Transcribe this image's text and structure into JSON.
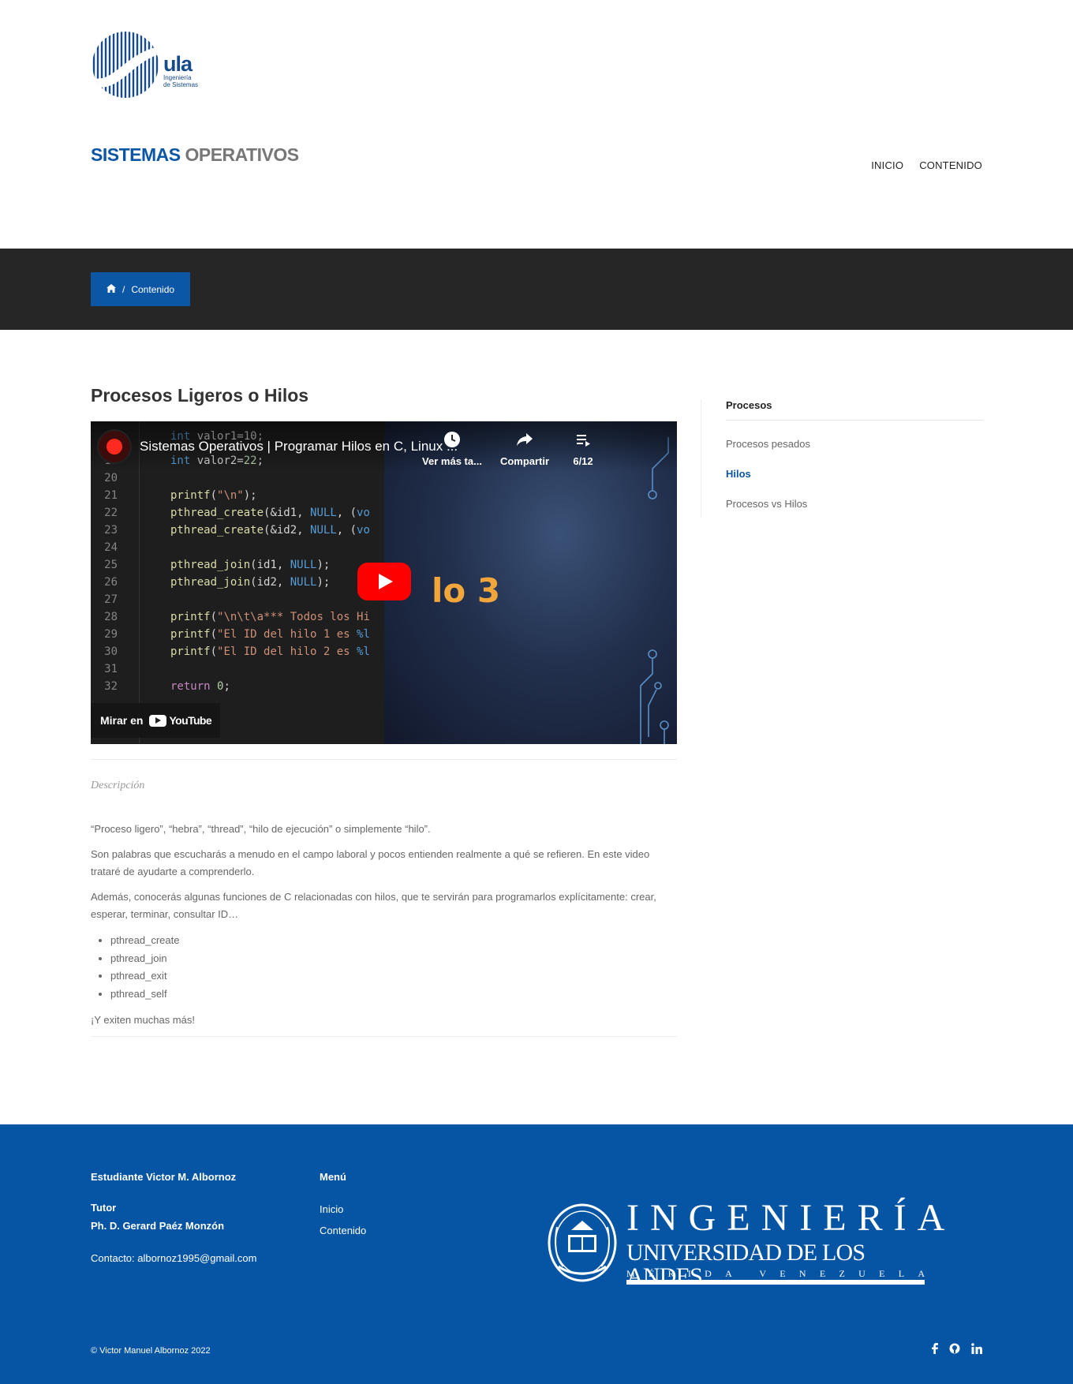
{
  "logo": {
    "ula": "ula",
    "sub1": "Ingeniería",
    "sub2": "de Sistemas"
  },
  "site_title": {
    "part1": "SISTEMAS",
    "part2": "OPERATIVOS"
  },
  "nav": {
    "inicio": "INICIO",
    "contenido": "CONTENIDO"
  },
  "breadcrumb": {
    "home_icon": "home-icon",
    "separator": "/",
    "current": "Contenido"
  },
  "main": {
    "title": "Procesos Ligeros o Hilos",
    "video": {
      "title": "Sistemas Operativos | Programar Hilos en C, Linux ...",
      "watch_later": "Ver más ta...",
      "share": "Compartir",
      "playlist_pos": "6/12",
      "art_title": "lo 3",
      "watch_on": "Mirar en",
      "youtube": "YouTube"
    },
    "description_label": "Descripción",
    "para1": "“Proceso ligero”, “hebra”, “thread”, “hilo de ejecución” o simplemente “hilo”.",
    "para2": "Son palabras que escucharás a menudo en el campo laboral y pocos entienden realmente a qué se refieren. En este video trataré de ayudarte a comprenderlo.",
    "para3": "Además, conocerás algunas funciones de C relacionadas con hilos, que te servirán para programarlos explícitamente: crear, esperar, terminar, consultar ID…",
    "functions": [
      "pthread_create",
      "pthread_join",
      "pthread_exit",
      "pthread_self"
    ],
    "para4": "¡Y exiten muchas más!"
  },
  "sidebar": {
    "heading": "Procesos",
    "items": [
      "Procesos pesados",
      "Hilos",
      "Procesos vs Hilos"
    ],
    "active_index": 1
  },
  "footer": {
    "student": "Estudiante Victor M. Albornoz",
    "tutor_label": "Tutor",
    "tutor_name": "Ph. D. Gerard Paéz Monzón",
    "contact": "Contacto: albornoz1995@gmail.com",
    "menu_heading": "Menú",
    "menu_items": [
      "Inicio",
      "Contenido"
    ],
    "brand_main": "INGENIERÍA",
    "brand_sub": "UNIVERSIDAD DE LOS ANDES",
    "brand_city": [
      "M",
      "É",
      "R",
      "I",
      "D",
      "A",
      " ",
      "V",
      "E",
      "N",
      "E",
      "Z",
      "U",
      "E",
      "L",
      "A"
    ],
    "copyright": "© Victor Manuel Albornoz 2022",
    "social": [
      "facebook-icon",
      "github-icon",
      "linkedin-icon"
    ]
  },
  "colors": {
    "primary": "#0c56a6",
    "dark_band": "#262626",
    "footer": "#0655a4"
  }
}
